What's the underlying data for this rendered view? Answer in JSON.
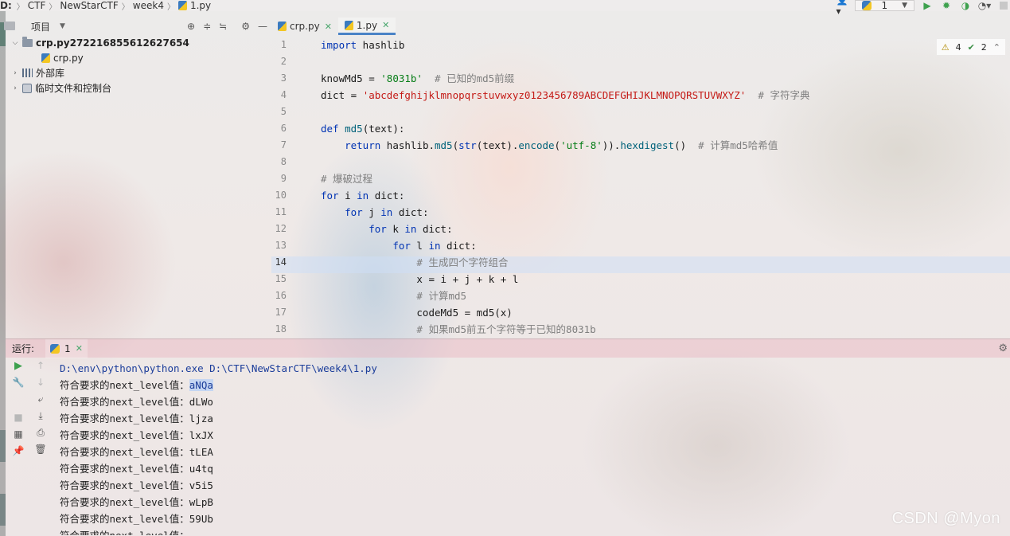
{
  "breadcrumb": {
    "drive": "D:",
    "items": [
      "CTF",
      "NewStarCTF",
      "week4"
    ],
    "file": "1.py"
  },
  "toolbar": {
    "run_config_label": "1",
    "user_icon": "user-icon",
    "run_icon": "run-icon",
    "debug_icon": "debug-icon",
    "coverage_icon": "coverage-icon",
    "profile_icon": "profile-icon",
    "stop_icon": "stop-icon"
  },
  "project_panel": {
    "title": "项目",
    "root": "crp.py272216855612627654",
    "children": [
      "crp.py"
    ],
    "external_libs": "外部库",
    "scratches": "临时文件和控制台"
  },
  "editor": {
    "tabs": [
      {
        "label": "crp.py",
        "active": false
      },
      {
        "label": "1.py",
        "active": true
      }
    ],
    "inspection": {
      "warnings": "4",
      "ok": "2"
    },
    "current_line": 14,
    "line_numbers": [
      "1",
      "2",
      "3",
      "4",
      "5",
      "6",
      "7",
      "8",
      "9",
      "10",
      "11",
      "12",
      "13",
      "14",
      "15",
      "16",
      "17",
      "18"
    ],
    "lines": [
      "import hashlib",
      "",
      "knowMd5 = '8031b'  # 已知的md5前缀",
      "dict = 'abcdefghijklmnopqrstuvwxyz0123456789ABCDEFGHIJKLMNOPQRSTUVWXYZ'  # 字符字典",
      "",
      "def md5(text):",
      "    return hashlib.md5(str(text).encode('utf-8')).hexdigest()  # 计算md5哈希值",
      "",
      "# 爆破过程",
      "for i in dict:",
      "    for j in dict:",
      "        for k in dict:",
      "            for l in dict:",
      "                # 生成四个字符组合",
      "                x = i + j + k + l",
      "                # 计算md5",
      "                codeMd5 = md5(x)",
      "                # 如果md5前五个字符等于已知的8031b"
    ]
  },
  "run_panel": {
    "label": "运行:",
    "tab_label": "1",
    "command": "D:\\env\\python\\python.exe D:\\CTF\\NewStarCTF\\week4\\1.py",
    "result_prefix": "符合要求的next_level值：",
    "results": [
      "aNQa",
      "dLWo",
      "ljza",
      "lxJX",
      "tLEA",
      "u4tq",
      "v5i5",
      "wLpB",
      "59Ub"
    ],
    "partial_last_line": "符合要求的next_level值：",
    "selected_result": "aNQa"
  },
  "watermark": "CSDN @Myon"
}
